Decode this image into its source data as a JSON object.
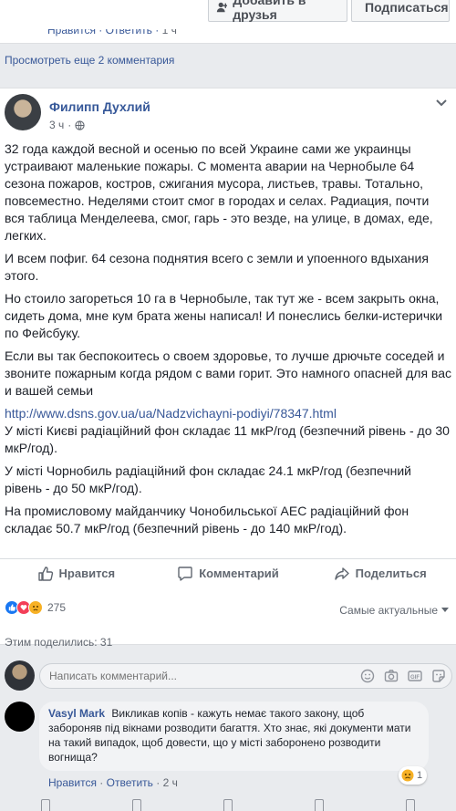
{
  "header": {
    "add_friend_label": "Добавить в друзья",
    "follow_label": "Подписаться"
  },
  "prev_comment": {
    "like_label": "Нравится",
    "reply_label": "Ответить",
    "time": "1 ч"
  },
  "view_more_comments": "Просмотреть еще 2 комментария",
  "post": {
    "author": "Филипп Духлий",
    "time": "3 ч",
    "paragraphs": [
      "32 года каждой весной и осенью по всей Украине сами же украинцы устраивают маленькие пожары. С момента аварии на Чернобыле 64 сезона пожаров, костров, сжигания мусора, листьев, травы. Тотально, повсеместно. Неделями стоит смог в городах и селах. Радиация, почти вся таблица Менделеева, смог, гарь - это везде, на улице, в домах, еде, легких.",
      "И всем пофиг. 64 сезона поднятия всего с земли и упоенного вдыхания этого.",
      "Но стоило загореться 10 га в Чернобыле, так тут же - всем закрыть окна, сидеть дома, мне кум брата жены написал! И понеслись белки-истерички по Фейсбуку.",
      "Если вы так беспокоитесь о своем здоровье, то лучше дрючьте соседей и звоните пожарным когда рядом с вами горит. Это намного опасней для вас и вашей семьи"
    ],
    "link": "http://www.dsns.gov.ua/ua/Nadzvichayni-podiyi/78347.html",
    "link_line_2": "У місті Києві радіаційний фон складає 11 мкР/год (безпечний рівень - до 30 мкР/год).",
    "paragraph_2": "У місті Чорнобиль радіаційний фон складає 24.1 мкР/год (безпечний рівень - до 50 мкР/год).",
    "paragraph_3": "На промисловому майданчику Чонобильської АЕС радіаційний фон складає 50.7 мкР/год (безпечний рівень - до 140 мкР/год)."
  },
  "actions": {
    "like": "Нравится",
    "comment": "Комментарий",
    "share": "Поделиться"
  },
  "reactions": {
    "count": "275",
    "sort_label": "Самые актуальные"
  },
  "shares_label": "Этим поделились: 31",
  "composer": {
    "placeholder": "Написать комментарий..."
  },
  "comment": {
    "author": "Vasyl Mark",
    "text": "Викликав копів - кажуть немає такого закону, щоб забороняв під вікнами розводити багаття. Хто знає, які документи мати на такий випадок, щоб довести, що у місті заборонено розводити вогнища?",
    "like_label": "Нравится",
    "reply_label": "Ответить",
    "time": "2 ч",
    "reaction_count": "1"
  },
  "colors": {
    "link": "#385898",
    "like_blue": "#1877f2",
    "love_red": "#f33e58",
    "haha_yellow": "#f7b125"
  }
}
